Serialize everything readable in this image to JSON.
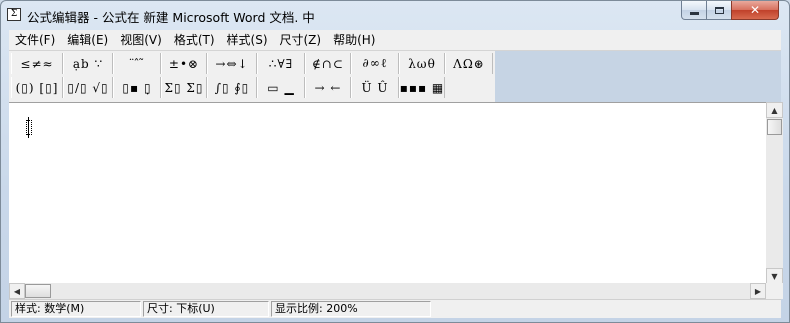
{
  "window": {
    "title": "公式编辑器 - 公式在 新建 Microsoft Word 文档. 中",
    "icon": "equation-editor-app-icon",
    "icon_glyph": "Σ"
  },
  "menu": [
    "文件(F)",
    "编辑(E)",
    "视图(V)",
    "格式(T)",
    "样式(S)",
    "尺寸(Z)",
    "帮助(H)"
  ],
  "toolbar": {
    "row1": [
      {
        "glyphs": "≤≠≈",
        "icon": "relational-symbols-icon"
      },
      {
        "glyphs": "ạb ∵",
        "icon": "spaces-and-ellipses-icon"
      },
      {
        "glyphs": "¨ ̂ ̃",
        "icon": "embellishments-icon"
      },
      {
        "glyphs": "±•⊗",
        "icon": "operator-symbols-icon"
      },
      {
        "glyphs": "→⇔↓",
        "icon": "arrow-symbols-icon"
      },
      {
        "glyphs": "∴∀∃",
        "icon": "logical-symbols-icon"
      },
      {
        "glyphs": "∉∩⊂",
        "icon": "set-theory-symbols-icon"
      },
      {
        "glyphs": "∂∞ℓ",
        "icon": "miscellaneous-symbols-icon"
      },
      {
        "glyphs": "λωθ",
        "icon": "greek-lowercase-icon"
      },
      {
        "glyphs": "ΛΩ⊛",
        "icon": "greek-uppercase-icon"
      }
    ],
    "row2": [
      {
        "glyphs": "(▯) [▯]",
        "icon": "fence-templates-icon"
      },
      {
        "glyphs": "▯/▯ √▯",
        "icon": "fraction-radical-templates-icon"
      },
      {
        "glyphs": "▯▪ ▯̣",
        "icon": "subscript-superscript-templates-icon"
      },
      {
        "glyphs": "Σ▯ Σ▯",
        "icon": "summation-templates-icon"
      },
      {
        "glyphs": "∫▯ ∮▯",
        "icon": "integral-templates-icon"
      },
      {
        "glyphs": "▭ ▁",
        "icon": "underbar-overbar-templates-icon"
      },
      {
        "glyphs": "→ ←",
        "icon": "labeled-arrow-templates-icon"
      },
      {
        "glyphs": "Ü Û",
        "icon": "products-set-theory-templates-icon"
      },
      {
        "glyphs": "▪▪▪ ▦",
        "icon": "matrix-templates-icon"
      }
    ]
  },
  "status": {
    "style": "样式: 数学(M)",
    "size": "尺寸: 下标(U)",
    "zoom": "显示比例: 200%"
  }
}
